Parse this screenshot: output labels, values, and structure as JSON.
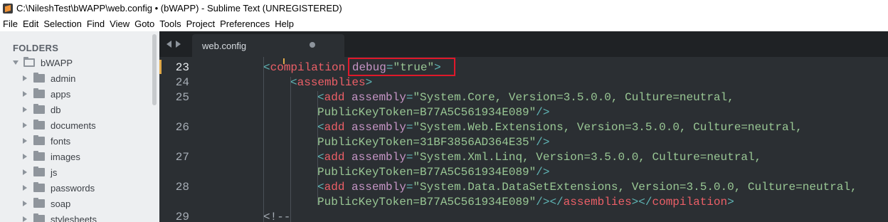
{
  "window": {
    "title": "C:\\NileshTest\\bWAPP\\web.config • (bWAPP) - Sublime Text (UNREGISTERED)"
  },
  "menu": [
    "File",
    "Edit",
    "Selection",
    "Find",
    "View",
    "Goto",
    "Tools",
    "Project",
    "Preferences",
    "Help"
  ],
  "sidebar": {
    "header": "FOLDERS",
    "root": "bWAPP",
    "folders": [
      "admin",
      "apps",
      "db",
      "documents",
      "fonts",
      "images",
      "js",
      "passwords",
      "soap",
      "stylesheets"
    ]
  },
  "tab": {
    "label": "web.config",
    "modified": true
  },
  "editor": {
    "line_numbers": [
      "23",
      "24",
      "25",
      "",
      "26",
      "",
      "27",
      "",
      "28",
      "",
      "29"
    ],
    "lines": [
      "<compilation debug=\"true\">",
      "<assemblies>",
      "<add assembly=\"System.Core, Version=3.5.0.0, Culture=neutral,",
      "PublicKeyToken=B77A5C561934E089\"/>",
      "<add assembly=\"System.Web.Extensions, Version=3.5.0.0, Culture=neutral,",
      "PublicKeyToken=31BF3856AD364E35\"/>",
      "<add assembly=\"System.Xml.Linq, Version=3.5.0.0, Culture=neutral,",
      "PublicKeyToken=B77A5C561934E089\"/>",
      "<add assembly=\"System.Data.DataSetExtensions, Version=3.5.0.0, Culture=neutral,",
      "PublicKeyToken=B77A5C561934E089\"/></assemblies></compilation>",
      "<!--"
    ]
  },
  "colors": {
    "highlight_box": "#e0182a",
    "tag": "#ec5f67",
    "attr": "#c594c5",
    "string": "#99c794",
    "punct": "#5fb4b4"
  }
}
